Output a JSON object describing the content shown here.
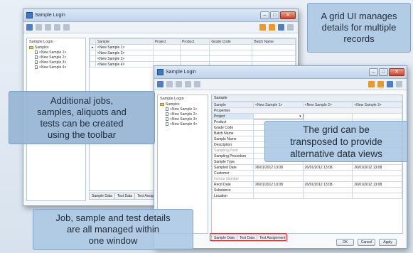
{
  "callouts": {
    "top_right": [
      "A grid UI manages",
      "details for multiple",
      "records"
    ],
    "left_middle": [
      "Additional jobs,",
      "samples, aliquots and",
      "tests can be created",
      "using the toolbar"
    ],
    "right_middle": [
      "The grid can be",
      "transposed to provide",
      "alternative data views"
    ],
    "bottom": [
      "Job, sample and test details",
      "are all managed within",
      "one window"
    ]
  },
  "back_window": {
    "title": "Sample Login",
    "tree_title": "Sample Login",
    "tree": [
      {
        "label": "Samples",
        "level": 0
      },
      {
        "label": "<New Sample 1>",
        "level": 1
      },
      {
        "label": "<New Sample 2>",
        "level": 1
      },
      {
        "label": "<New Sample 3>",
        "level": 1
      },
      {
        "label": "<New Sample 4>",
        "level": 1
      }
    ],
    "grid_headers": [
      "Sample",
      "Project",
      "Product",
      "Grade Code",
      "Batch Name"
    ],
    "grid_rows": [
      "<New Sample 1>",
      "<New Sample 2>",
      "<New Sample 3>",
      "<New Sample 4>"
    ],
    "tabs": [
      "Sample Data",
      "Test Data",
      "Test Assign"
    ]
  },
  "front_window": {
    "title": "Sample Login",
    "tree_title": "Sample Login",
    "tree": [
      {
        "label": "Samples",
        "level": 0
      },
      {
        "label": "<New Sample 1>",
        "level": 1
      },
      {
        "label": "<New Sample 2>",
        "level": 1
      },
      {
        "label": "<New Sample 3>",
        "level": 1
      },
      {
        "label": "<New Sample 4>",
        "level": 1
      }
    ],
    "grid_header_label": "Sample",
    "grid_columns": [
      "Sample",
      "<New Sample 1>",
      "<New Sample 2>",
      "<New Sample 3>"
    ],
    "section_label": "Properties",
    "property_rows": [
      {
        "name": "Project",
        "v1": "",
        "v2": "",
        "v3": ""
      },
      {
        "name": "Product",
        "v1": "",
        "v2": "",
        "v3": ""
      },
      {
        "name": "Grade Code",
        "v1": "",
        "v2": "",
        "v3": ""
      },
      {
        "name": "Batch Name",
        "v1": "",
        "v2": "",
        "v3": ""
      },
      {
        "name": "Sample Name",
        "v1": "",
        "v2": "",
        "v3": ""
      },
      {
        "name": "Description",
        "v1": "",
        "v2": "",
        "v3": ""
      },
      {
        "name": "Sampling Point",
        "v1": "",
        "v2": "",
        "v3": ""
      },
      {
        "name": "Sampling Procedure",
        "v1": "",
        "v2": "",
        "v3": ""
      },
      {
        "name": "Sample Type",
        "v1": "",
        "v2": "",
        "v3": ""
      },
      {
        "name": "Sampled Date",
        "v1": "26/01/2012 13:08",
        "v2": "26/01/2012 13:08",
        "v3": "26/01/2012 13:08"
      },
      {
        "name": "Customer",
        "v1": "",
        "v2": "",
        "v3": ""
      },
      {
        "name": "Invoice Number",
        "v1": "",
        "v2": "",
        "v3": ""
      },
      {
        "name": "Recd Date",
        "v1": "26/01/2012 13:08",
        "v2": "26/01/2012 13:08",
        "v3": "26/01/2012 13:08"
      },
      {
        "name": "Substance",
        "v1": "",
        "v2": "",
        "v3": ""
      },
      {
        "name": "Location",
        "v1": "",
        "v2": "",
        "v3": ""
      }
    ],
    "tabs": [
      "Sample Data",
      "Test Data",
      "Test Assignment"
    ],
    "buttons": {
      "ok": "OK",
      "cancel": "Cancel",
      "apply": "Apply"
    }
  }
}
